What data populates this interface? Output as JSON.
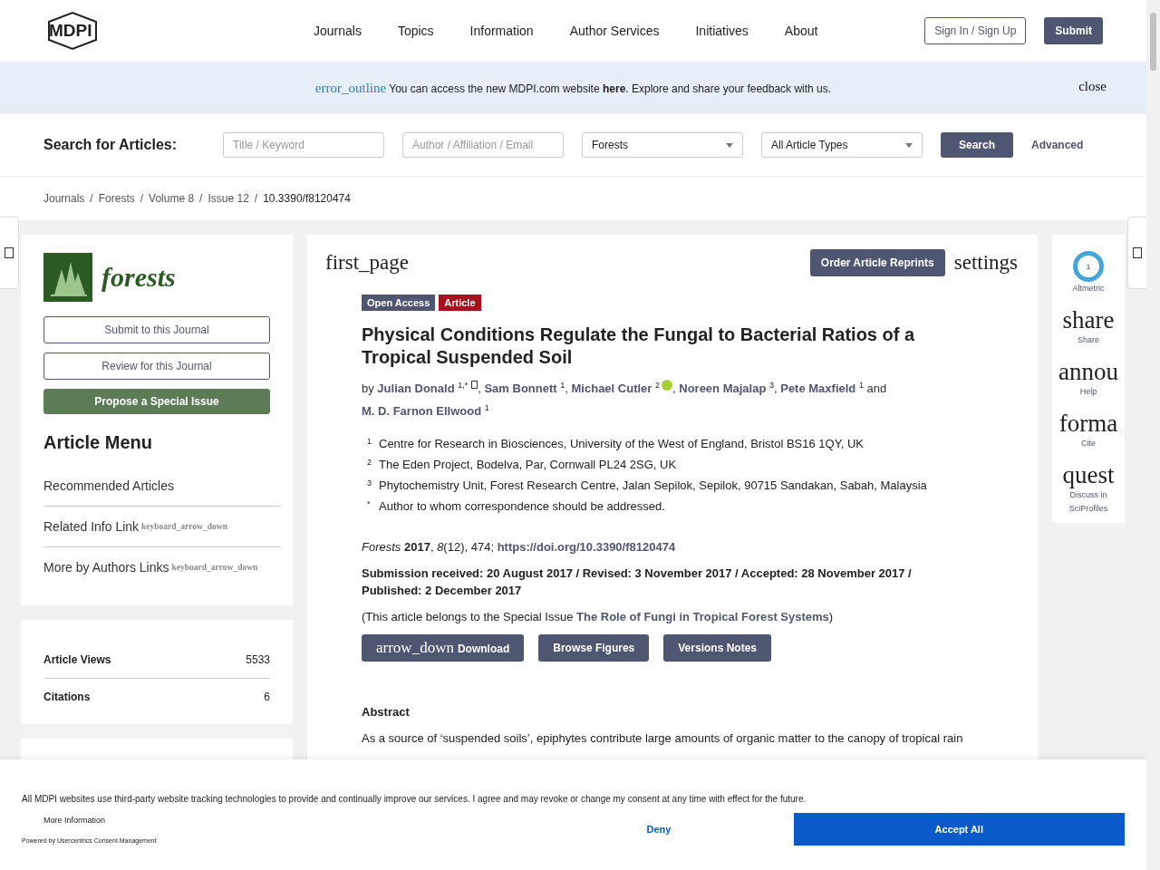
{
  "header": {
    "logo": "MDPI",
    "nav": [
      "Journals",
      "Topics",
      "Information",
      "Author Services",
      "Initiatives",
      "About"
    ],
    "sign_in": "Sign In / Sign Up",
    "submit": "Submit"
  },
  "banner": {
    "icon_text": "error_outline",
    "before": "You can access the new MDPI.com website ",
    "link": "here",
    "after": ". Explore and share your feedback with us.",
    "close": "close"
  },
  "search": {
    "label": "Search for Articles:",
    "fields": [
      {
        "kind": "input",
        "placeholder": "Title / Keyword"
      },
      {
        "kind": "input",
        "placeholder": "Author / Affiliation / Email"
      },
      {
        "kind": "select",
        "value": "Forests"
      },
      {
        "kind": "select",
        "value": "All Article Types"
      }
    ],
    "button": "Search",
    "advanced": "Advanced"
  },
  "breadcrumb_separator": "/",
  "breadcrumb": [
    "Journals",
    "Forests",
    "Volume 8",
    "Issue 12",
    "10.3390/f8120474"
  ],
  "sidebar": {
    "journal": "forests",
    "buttons": [
      {
        "label": "Submit to this Journal",
        "kind": "outline"
      },
      {
        "label": "Review for this Journal",
        "kind": "outline"
      },
      {
        "label": "Propose a Special Issue",
        "kind": "filled"
      }
    ],
    "menu_title": "Article Menu",
    "menu": [
      {
        "label": "Recommended Articles"
      },
      {
        "label": "Related Info Link",
        "icon_text": "keyboard_arrow_down"
      },
      {
        "label": "More by Authors Links",
        "icon_text": "keyboard_arrow_down"
      }
    ],
    "stats": [
      {
        "label": "Article Views",
        "value": "5533"
      },
      {
        "label": "Citations",
        "value": "6"
      }
    ]
  },
  "article": {
    "first_page": "first_page",
    "reprints": "Order Article Reprints",
    "settings": "settings",
    "badges": [
      {
        "label": "Open Access",
        "color": "#4f5671"
      },
      {
        "label": "Article",
        "color": "#a3121e"
      }
    ],
    "title": "Physical Conditions Regulate the Fungal to Bacterial Ratios of a Tropical Suspended Soil",
    "by": "by",
    "and": "and",
    "author_separator": ",",
    "authors": [
      {
        "name": "Julian Donald",
        "sup": "1,*",
        "email": true
      },
      {
        "name": "Sam Bonnett",
        "sup": "1"
      },
      {
        "name": "Michael Cutler",
        "sup": "2",
        "orcid": true
      },
      {
        "name": "Noreen Majalap",
        "sup": "3"
      },
      {
        "name": "Pete Maxfield",
        "sup": "1"
      },
      {
        "name": "M. D. Farnon Ellwood",
        "sup": "1"
      }
    ],
    "affiliations": [
      {
        "mark": "1",
        "text": "Centre for Research in Biosciences, University of the West of England, Bristol BS16 1QY, UK"
      },
      {
        "mark": "2",
        "text": "The Eden Project, Bodelva, Par, Cornwall PL24 2SG, UK"
      },
      {
        "mark": "3",
        "text": "Phytochemistry Unit, Forest Research Centre, Jalan Sepilok, Sepilok, 90715 Sandakan, Sabah, Malaysia"
      },
      {
        "mark": "*",
        "text": "Author to whom correspondence should be addressed."
      }
    ],
    "citation": "*Forests* **2017**, *8*(12), 474; ",
    "doi": "https://doi.org/10.3390/f8120474",
    "dates": "Submission received: 20 August 2017 / Revised: 3 November 2017 / Accepted: 28 November 2017 / Published: 2 December 2017",
    "special_issue_before": "(This article belongs to the Special Issue ",
    "special_issue": "The Role of Fungi in Tropical Forest Systems",
    "special_issue_after": ")",
    "actions": [
      {
        "label": "Download",
        "icon_text": "arrow_down"
      },
      {
        "label": "Browse Figures"
      },
      {
        "label": "Versions Notes"
      }
    ],
    "abstract_title": "Abstract",
    "abstract": "As a source of ‘suspended soils’, epiphytes contribute large amounts of organic matter to the canopy of tropical rain"
  },
  "rail": [
    {
      "kind": "badge",
      "label": "Altmetric",
      "badge": "1"
    },
    {
      "kind": "glyph",
      "glyph": "share",
      "label": "Share"
    },
    {
      "kind": "glyph",
      "glyph": "annou",
      "label": "Help"
    },
    {
      "kind": "glyph",
      "glyph": "forma",
      "label": "Cite"
    },
    {
      "kind": "glyph",
      "glyph": "quest",
      "label": "Discuss in SciProfiles"
    }
  ],
  "consent": {
    "text": "All MDPI websites use third-party website tracking technologies to provide and continually improve our services. I agree and may revoke or change my consent at any time with effect for the future.",
    "more": "More Information",
    "powered": "Powered by Usercentrics Consent Management",
    "deny": "Deny",
    "accept": "Accept All"
  }
}
